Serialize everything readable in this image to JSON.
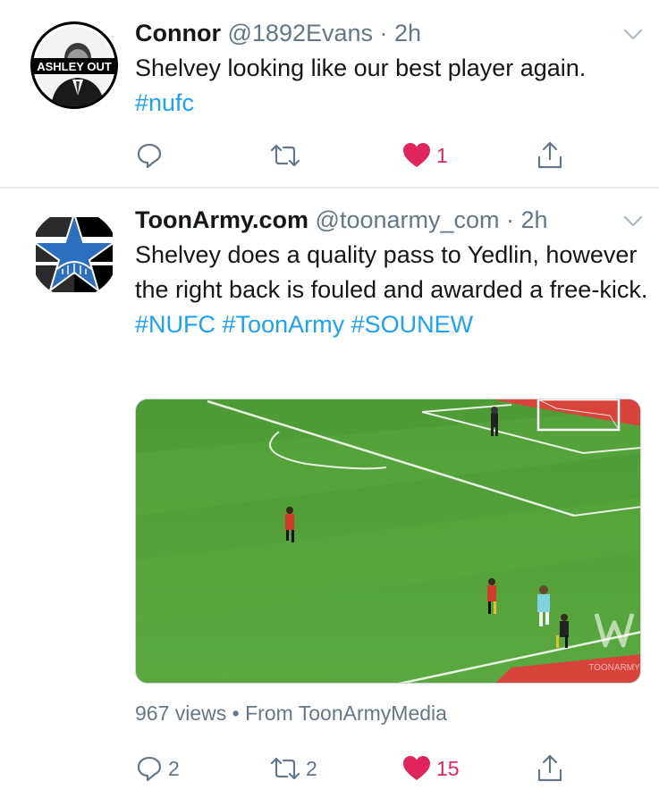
{
  "tweets": [
    {
      "name": "Connor",
      "handle": "@1892Evans",
      "time": "2h",
      "text_plain": "Shelvey looking like our best player again. ",
      "hashtags": [
        "#nufc"
      ],
      "avatar_text": "ASHLEY OUT",
      "replies": "",
      "retweets": "",
      "likes": "1",
      "liked": true
    },
    {
      "name": "ToonArmy.com",
      "handle": "@toonarmy_com",
      "time": "2h",
      "text_plain": "Shelvey does a quality pass to Yedlin, however the right back is fouled and awarded a free-kick. ",
      "hashtags": [
        "#NUFC",
        "#ToonArmy",
        "#SOUNEW"
      ],
      "media_watermark": "TOONARMY",
      "views": "967 views",
      "separator": "•",
      "source": "From ToonArmyMedia",
      "replies": "2",
      "retweets": "2",
      "likes": "15",
      "liked": true
    }
  ],
  "colors": {
    "accent": "#1da1f2",
    "like": "#e0245e",
    "muted": "#657786",
    "pitch": "#55a23b"
  },
  "icons": [
    "reply-icon",
    "retweet-icon",
    "heart-icon",
    "share-icon",
    "chevron-down-icon"
  ]
}
